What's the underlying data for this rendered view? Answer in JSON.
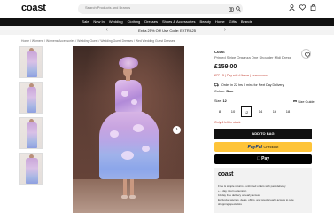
{
  "header": {
    "logo": "coast",
    "search_placeholder": "Search Products and Brands",
    "icons": [
      "camera-icon",
      "search-icon",
      "user-icon",
      "heart-icon",
      "bag-icon"
    ]
  },
  "nav": {
    "items": [
      "Sale",
      "New In",
      "Wedding",
      "Clothing",
      "Dresses",
      "Shoes & Accessories",
      "Beauty",
      "Home",
      "Gifts",
      "Brands"
    ]
  },
  "promo": {
    "text": "Extra 25% Off! Use Code: EXTRA25"
  },
  "breadcrumb": "Home / Womens / Womens Accessories / Wedding Guest / Wedding Guest Dresses / Wed Wedding Guest Dresses",
  "product": {
    "brand": "Coast",
    "name": "Printed Stripe Organza One Shoulder Midi Dress",
    "price": "£159.00",
    "klarna": "£77 | 3 | Pay with Klarna | Learn more",
    "delivery": "Order in 22 hrs 0 mins for Next Day Delivery",
    "colour_label": "Colour:",
    "colour_value": "Blue",
    "size_label": "Size:",
    "size_value": "12",
    "size_guide": "Size Guide",
    "sizes": [
      "8",
      "10",
      "12",
      "14",
      "16",
      "18"
    ],
    "selected_size": "12",
    "stock": "Only 4 left in stock",
    "add_to_bag": "ADD TO BAG",
    "paypal_brand": "PayPal",
    "paypal_checkout": "Checkout",
    "apple_pay": "Pay"
  },
  "promo_box": {
    "logo": "coast",
    "sub": "",
    "lines": [
      "Free & simple returns - unlimited orders with paid delivery",
      "+ 4 day return extension",
      "10 day free delivery on early access",
      "Exclusive savings, deals, offers, and special early access to sale",
      "shopping specialists"
    ]
  },
  "colors": {
    "nav_bg": "#111111",
    "promo_bg": "#f3f3f3",
    "klarna_text": "#c0392b",
    "add_to_bag_bg": "#111111",
    "paypal_bg": "#fec439",
    "paypal_blue": "#003087",
    "apple_pay_bg": "#000000"
  }
}
